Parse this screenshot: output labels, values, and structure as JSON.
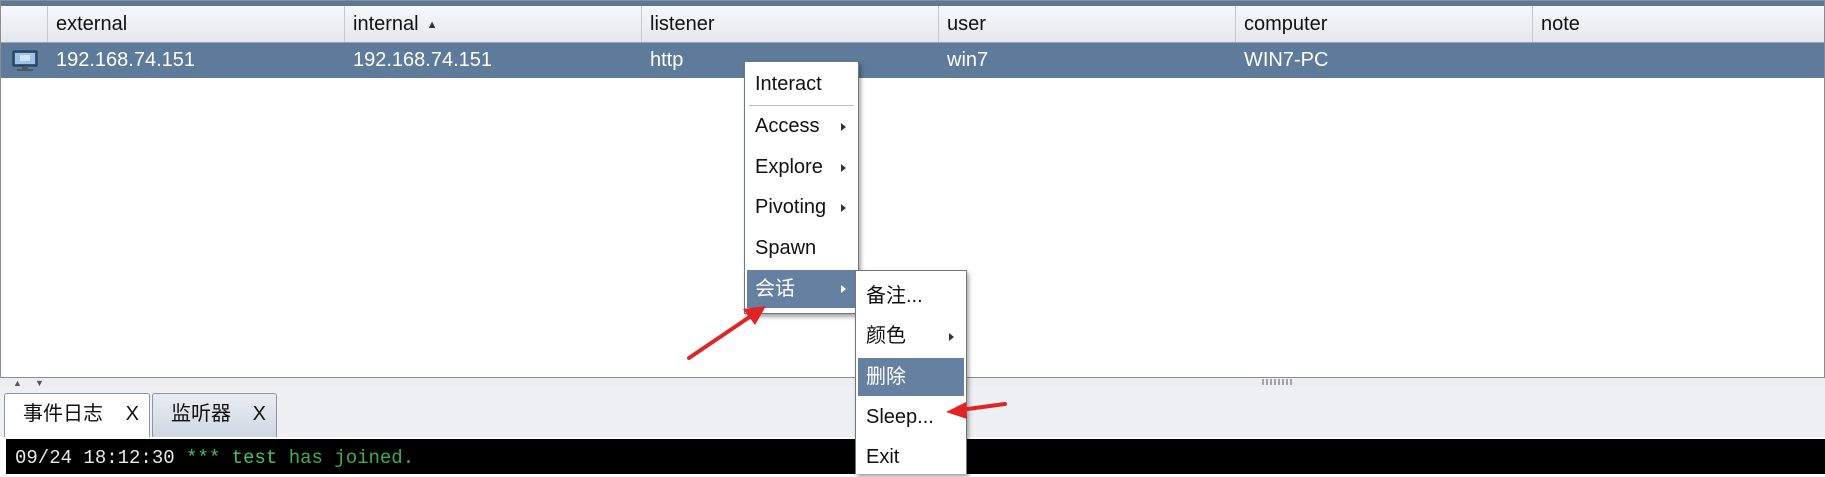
{
  "table": {
    "columns": [
      "external",
      "internal",
      "listener",
      "user",
      "computer",
      "note"
    ],
    "sort_indicator": "▲",
    "rows": [
      {
        "external": "192.168.74.151",
        "internal": "192.168.74.151",
        "listener": "http",
        "user": "win7",
        "computer": "WIN7-PC",
        "note": "",
        "selected": true
      }
    ]
  },
  "context_menu": {
    "items": [
      {
        "label": "Interact",
        "submenu": false
      },
      {
        "label": "Access",
        "submenu": true
      },
      {
        "label": "Explore",
        "submenu": true
      },
      {
        "label": "Pivoting",
        "submenu": true
      },
      {
        "label": "Spawn",
        "submenu": false
      },
      {
        "label": "会话",
        "submenu": true,
        "highlighted": true
      }
    ]
  },
  "session_submenu": {
    "items": [
      {
        "label": "备注...",
        "submenu": false
      },
      {
        "label": "颜色",
        "submenu": true
      },
      {
        "label": "删除",
        "submenu": false,
        "highlighted": true
      },
      {
        "label": "Sleep...",
        "submenu": false
      },
      {
        "label": "Exit",
        "submenu": false
      }
    ]
  },
  "tabs": [
    {
      "label": "事件日志",
      "close": "X",
      "active": true
    },
    {
      "label": "监听器",
      "close": "X",
      "active": false
    }
  ],
  "console": {
    "timestamp": "09/24 18:12:30",
    "stars": "***",
    "user": "test",
    "message": "has joined."
  },
  "colors": {
    "selection": "#5e7b9b",
    "menu_highlight": "#6580a1",
    "annotation_arrow": "#e02424",
    "console_green": "#46c35a"
  }
}
